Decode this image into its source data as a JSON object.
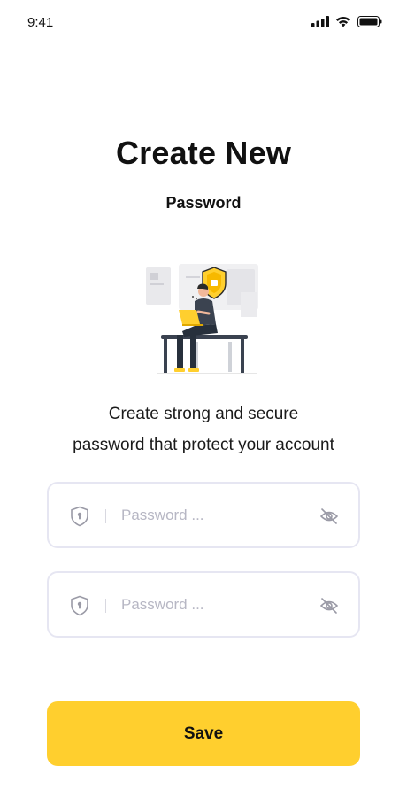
{
  "status_bar": {
    "time": "9:41",
    "icons": [
      "signal-icon",
      "wifi-icon",
      "battery-icon"
    ]
  },
  "header": {
    "title": "Create New",
    "subtitle": "Password"
  },
  "illustration": {
    "icon": "person-laptop-shield-illustration"
  },
  "description": {
    "line1": "Create strong and secure",
    "line2": "password that protect your account"
  },
  "fields": [
    {
      "placeholder": "Password ...",
      "value": "",
      "left_icon": "shield-lock-icon",
      "right_icon": "eye-off-icon"
    },
    {
      "placeholder": "Password ...",
      "value": "",
      "left_icon": "shield-lock-icon",
      "right_icon": "eye-off-icon"
    }
  ],
  "actions": {
    "save_label": "Save"
  },
  "colors": {
    "accent": "#ffcf2e",
    "field_border": "#e6e6f2",
    "placeholder": "#b7b7c4",
    "text": "#111111"
  }
}
